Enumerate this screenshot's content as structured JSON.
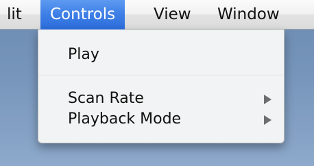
{
  "menubar": {
    "items": [
      {
        "label": "lit"
      },
      {
        "label": "Controls"
      },
      {
        "label": "View"
      },
      {
        "label": "Window"
      }
    ]
  },
  "menu": {
    "items": [
      {
        "label": "Play",
        "has_submenu": false
      },
      {
        "label": "Scan Rate",
        "has_submenu": true
      },
      {
        "label": "Playback Mode",
        "has_submenu": true
      }
    ]
  },
  "colors": {
    "highlight": "#3d7ee6",
    "desktop": "#7795bb"
  }
}
